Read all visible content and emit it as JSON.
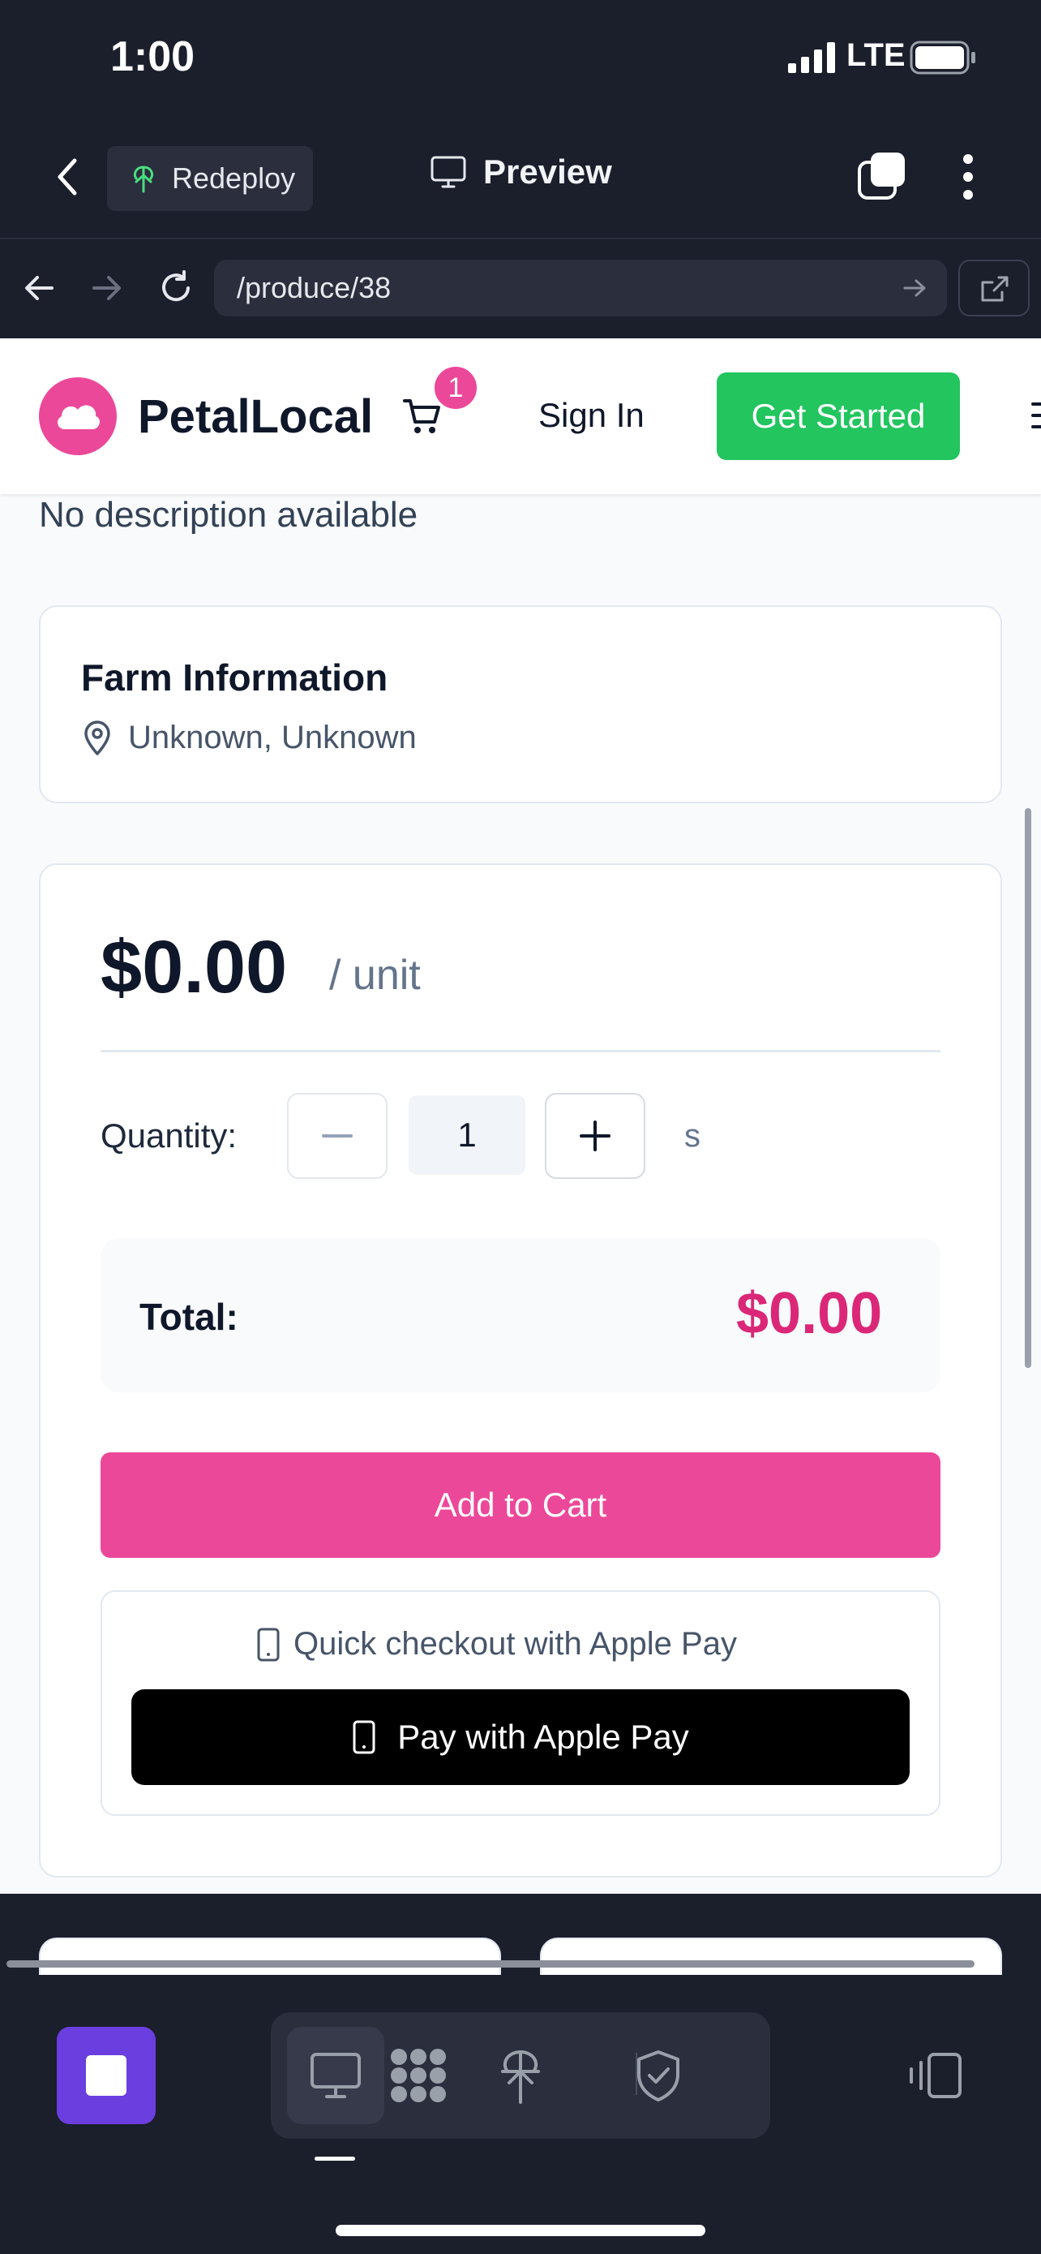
{
  "status": {
    "time": "1:00",
    "network": "LTE"
  },
  "header": {
    "redeploy_label": "Redeploy",
    "preview_label": "Preview"
  },
  "urlbar": {
    "url": "/produce/38"
  },
  "site": {
    "brand": "PetalLocal",
    "cart_count": "1",
    "signin_label": "Sign In",
    "getstarted_label": "Get Started"
  },
  "product": {
    "description": "No description available",
    "farm_title": "Farm Information",
    "farm_location": "Unknown, Unknown",
    "price": "$0.00",
    "unit": "/ unit",
    "quantity_label": "Quantity:",
    "quantity_value": "1",
    "quantity_suffix": "s",
    "total_label": "Total:",
    "total_value": "$0.00",
    "add_to_cart_label": "Add to Cart",
    "quick_checkout_label": "Quick checkout with Apple Pay",
    "apple_pay_label": "Pay with Apple Pay"
  },
  "colors": {
    "brand_pink": "#ec4899",
    "cta_green": "#22c55e",
    "total_pink": "#db2777",
    "stop_purple": "#6b3ee0"
  },
  "toolbar": {
    "icons": [
      "stop-icon",
      "desktop-preview-icon",
      "apps-grid-icon",
      "deploy-icon",
      "shield-check-icon",
      "device-toggle-icon"
    ]
  }
}
